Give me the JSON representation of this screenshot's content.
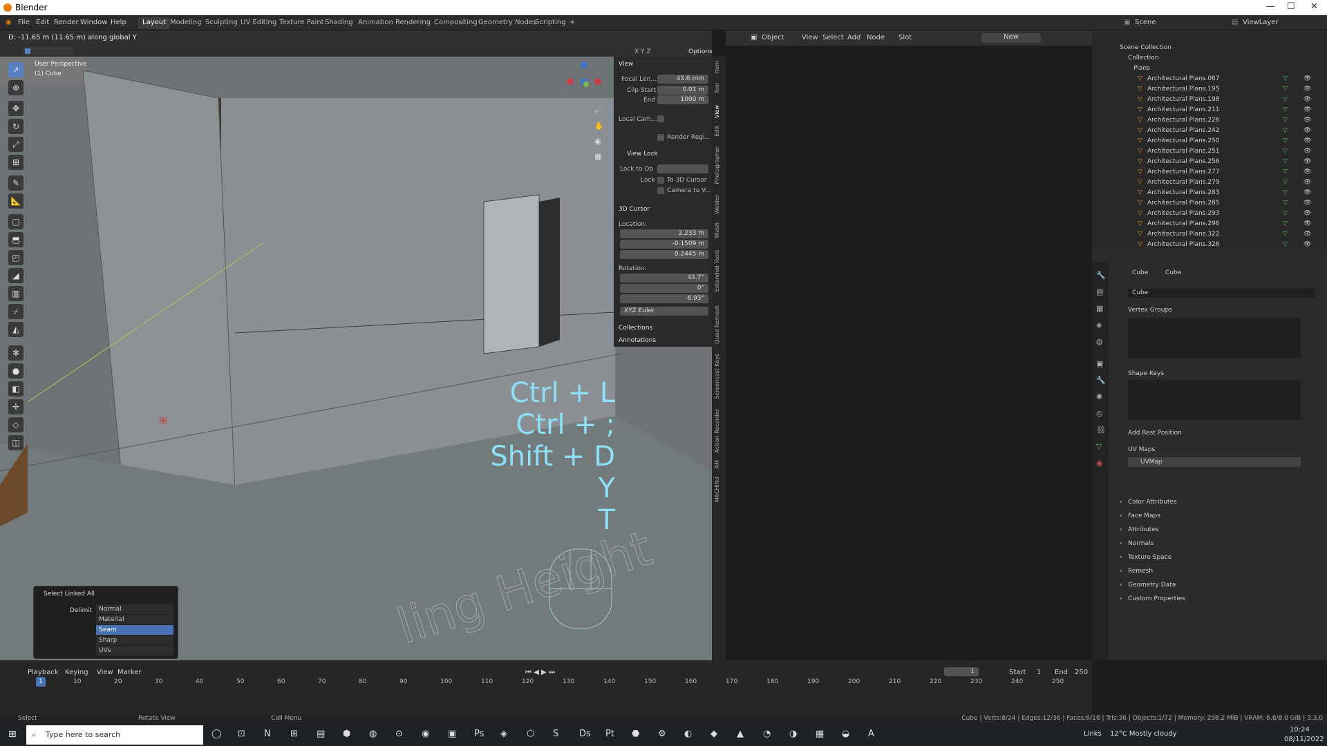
{
  "window": {
    "title": "Blender"
  },
  "menu": {
    "items": [
      "File",
      "Edit",
      "Render",
      "Window",
      "Help"
    ],
    "workspaces": [
      "Layout",
      "Modeling",
      "Sculpting",
      "UV Editing",
      "Texture Paint",
      "Shading",
      "Animation",
      "Rendering",
      "Compositing",
      "Geometry Nodes",
      "Scripting",
      "+"
    ],
    "active_workspace": "Layout",
    "scene": "Scene",
    "viewlayer": "ViewLayer"
  },
  "viewport": {
    "status_text": "D: -11.65 m (11.65 m) along global Y",
    "perspective": "User Perspective",
    "object": "(1) Cube",
    "options": "Options",
    "axes": "X Y Z",
    "shortcuts": [
      "Ctrl + L",
      "Ctrl + ;",
      "Shift + D",
      "Y",
      "T"
    ],
    "floor_text": "ling Height"
  },
  "npanel": {
    "view_title": "View",
    "focal_label": "Focal Len...",
    "focal": "43.6 mm",
    "clip_start_label": "Clip Start",
    "clip_start": "0.01 m",
    "end_label": "End",
    "end": "1000 m",
    "local_cam": "Local Cam...",
    "render_region": "Render Regi...",
    "view_lock": "View Lock",
    "lock_to_ob": "Lock to Ob",
    "lock": "Lock",
    "to_3d_cursor": "To 3D Cursor",
    "camera_to_v": "Camera to V...",
    "cursor_title": "3D Cursor",
    "location": "Location:",
    "lx": "2.233 m",
    "ly": "-0.1509 m",
    "lz": "0.2445 m",
    "rotation": "Rotation:",
    "rx": "43.7°",
    "ry": "0°",
    "rz": "-6.93°",
    "euler": "XYZ Euler",
    "collections": "Collections",
    "annotations": "Annotations",
    "x": "X",
    "y": "Y",
    "z": "Z"
  },
  "sidetabs": [
    "Item",
    "Tool",
    "View",
    "Edit",
    "Photographer",
    "Welder",
    "IMesh",
    "Extended Tools",
    "Quad Remesh",
    "Screencast Keys",
    "Action Recorder",
    "AM",
    "MACHIN3"
  ],
  "nodeeditor": {
    "mode": "Object",
    "menus": [
      "View",
      "Select",
      "Add",
      "Node"
    ],
    "slot": "Slot",
    "new": "New"
  },
  "outliner": {
    "scene_collection": "Scene Collection",
    "collection": "Collection",
    "plans": "Plans",
    "items": [
      "Architectural Plans.067",
      "Architectural Plans.195",
      "Architectural Plans.198",
      "Architectural Plans.211",
      "Architectural Plans.226",
      "Architectural Plans.242",
      "Architectural Plans.250",
      "Architectural Plans.251",
      "Architectural Plans.256",
      "Architectural Plans.277",
      "Architectural Plans.279",
      "Architectural Plans.283",
      "Architectural Plans.285",
      "Architectural Plans.293",
      "Architectural Plans.296",
      "Architectural Plans.322",
      "Architectural Plans.326"
    ]
  },
  "properties": {
    "breadcrumb_obj": "Cube",
    "breadcrumb_mesh": "Cube",
    "mesh_name": "Cube",
    "vertex_groups": "Vertex Groups",
    "shape_keys": "Shape Keys",
    "add_rest": "Add Rest Position",
    "uv_maps": "UV Maps",
    "uvmap": "UVMap",
    "panels": [
      "Color Attributes",
      "Face Maps",
      "Attributes",
      "Normals",
      "Texture Space",
      "Remesh",
      "Geometry Data",
      "Custom Properties"
    ]
  },
  "popup": {
    "title": "Select Linked All",
    "delimit": "Delimit",
    "options": [
      "Normal",
      "Material",
      "Seam",
      "Sharp",
      "UVs"
    ],
    "selected": "Seam"
  },
  "timeline": {
    "menus": [
      "Playback",
      "Keying",
      "View",
      "Marker"
    ],
    "current": "1",
    "start_label": "Start",
    "start": "1",
    "end_label": "End",
    "end": "250",
    "ticks": [
      "10",
      "20",
      "30",
      "40",
      "50",
      "60",
      "70",
      "80",
      "90",
      "100",
      "110",
      "120",
      "130",
      "140",
      "150",
      "160",
      "170",
      "180",
      "190",
      "200",
      "210",
      "220",
      "230",
      "240",
      "250"
    ]
  },
  "status": {
    "select": "Select",
    "rotate": "Rotate View",
    "call": "Call Menu",
    "stats": "Cube | Verts:8/24 | Edges:12/36 | Faces:6/18 | Tris:36 | Objects:1/72 | Memory: 298.2 MiB | VRAM: 6.6/8.0 GiB | 3.3.0"
  },
  "taskbar": {
    "search": "Type here to search",
    "links": "Links",
    "weather": "12°C  Mostly cloudy",
    "time": "10:24",
    "date": "08/11/2022"
  }
}
